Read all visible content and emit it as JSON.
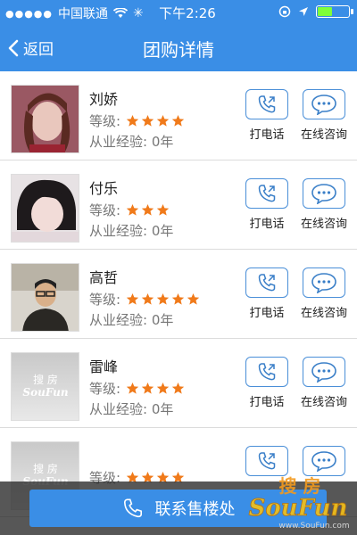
{
  "status_bar": {
    "carrier": "中国联通",
    "time": "下午2:26",
    "battery_percent": 45
  },
  "nav": {
    "back_label": "返回",
    "title": "团购详情"
  },
  "list": {
    "items": [
      {
        "name": "刘娇",
        "level_label": "等级:",
        "stars": 4,
        "experience": "从业经验: 0年",
        "call_label": "打电话",
        "chat_label": "在线咨询"
      },
      {
        "name": "付乐",
        "level_label": "等级:",
        "stars": 3,
        "experience": "从业经验: 0年",
        "call_label": "打电话",
        "chat_label": "在线咨询"
      },
      {
        "name": "高哲",
        "level_label": "等级:",
        "stars": 5,
        "experience": "从业经验: 0年",
        "call_label": "打电话",
        "chat_label": "在线咨询"
      },
      {
        "name": "雷峰",
        "level_label": "等级:",
        "stars": 4,
        "experience": "从业经验: 0年",
        "call_label": "打电话",
        "chat_label": "在线咨询"
      },
      {
        "name": "",
        "level_label": "等级:",
        "stars": 4,
        "experience": "",
        "call_label": "",
        "chat_label": ""
      }
    ]
  },
  "footer": {
    "contact_label": "联系售楼处"
  },
  "colors": {
    "brand_blue": "#3a8ee6",
    "star_orange": "#f07a1a"
  }
}
